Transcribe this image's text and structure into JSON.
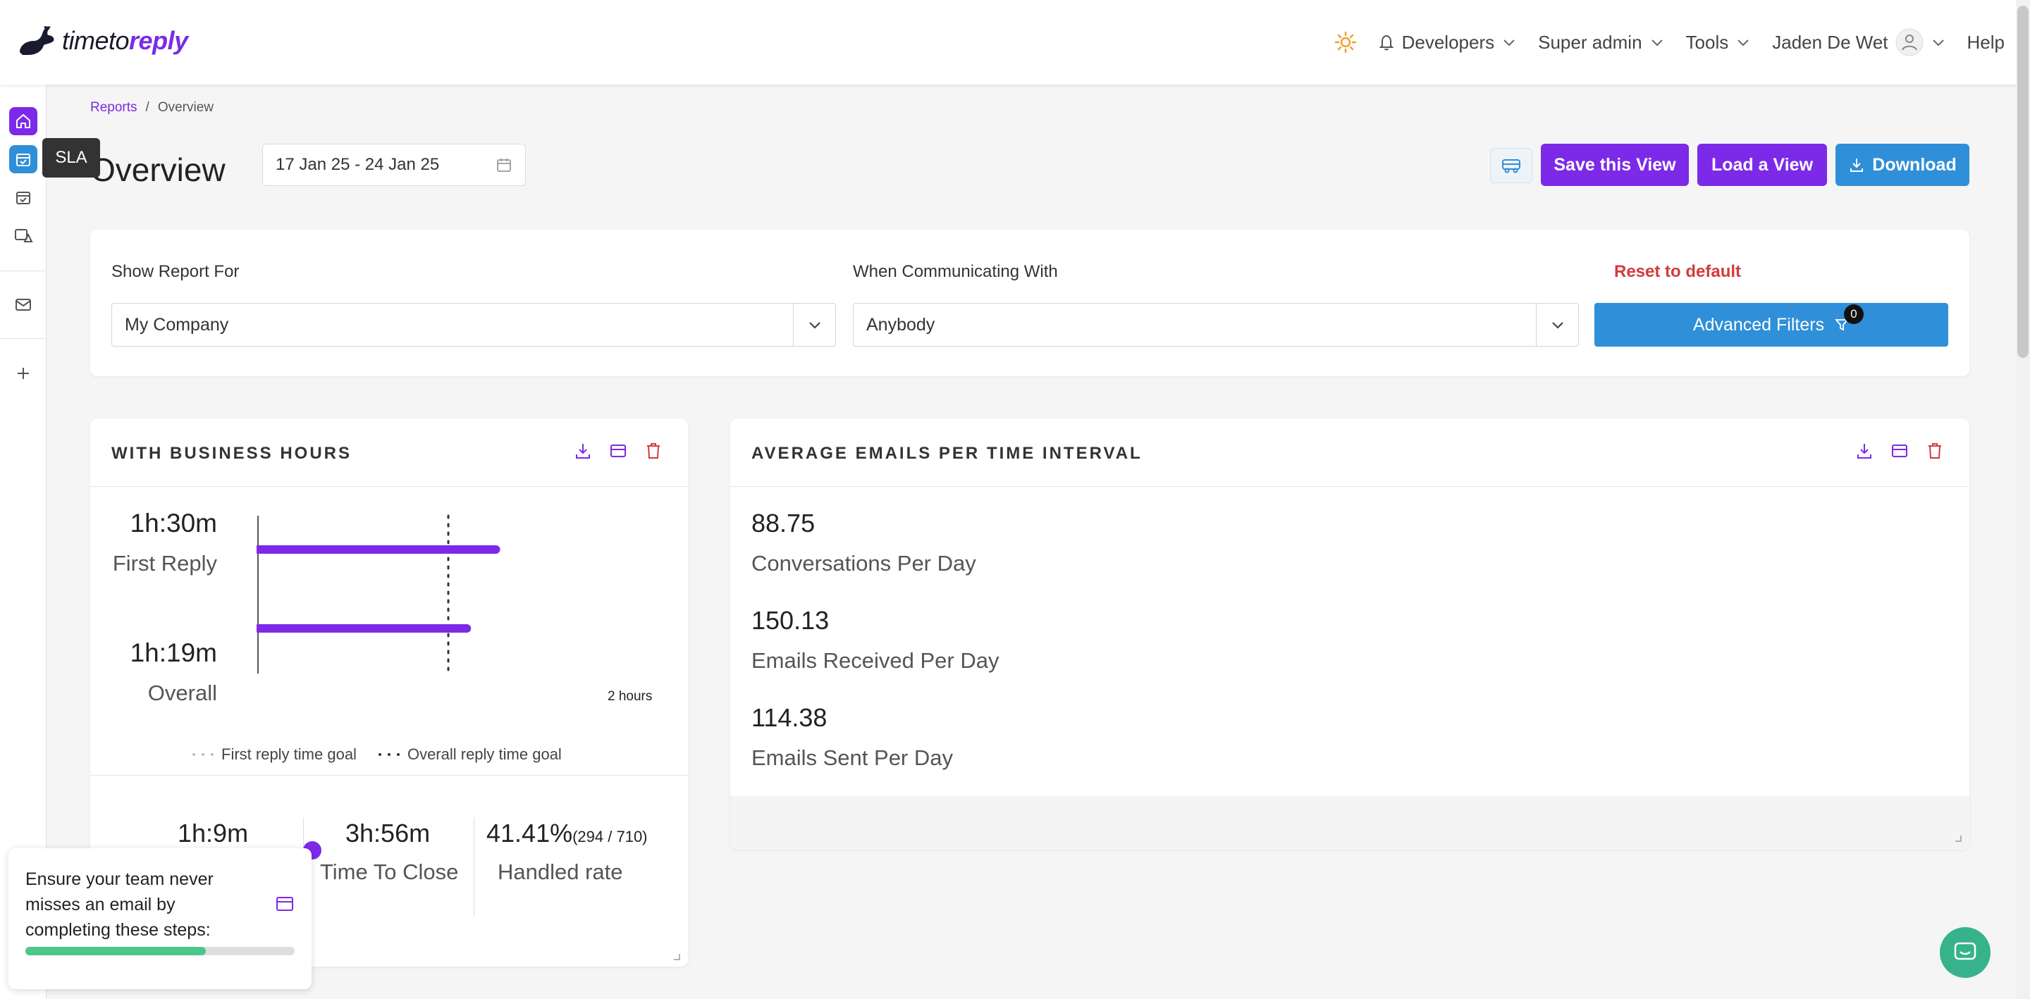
{
  "app": {
    "logo_text_light": "timeto",
    "logo_text_bold": "reply"
  },
  "nav": {
    "developers": "Developers",
    "super_admin": "Super admin",
    "tools": "Tools",
    "user": "Jaden De Wet",
    "help": "Help"
  },
  "sidebar": {
    "tooltip": "SLA"
  },
  "breadcrumb": {
    "reports": "Reports",
    "separator": "/",
    "current": "Overview"
  },
  "header": {
    "title": "Overview",
    "date_range": "17 Jan 25 - 24 Jan 25",
    "save_view": "Save this View",
    "load_view": "Load a View",
    "download": "Download"
  },
  "filters": {
    "report_for_label": "Show Report For",
    "report_for_value": "My Company",
    "communicating_label": "When Communicating With",
    "communicating_value": "Anybody",
    "reset": "Reset to default",
    "advanced": "Advanced Filters",
    "advanced_count": "0"
  },
  "business_hours": {
    "title": "WITH BUSINESS HOURS",
    "first_reply_time": "1h:30m",
    "first_reply_label": "First Reply",
    "overall_time": "1h:19m",
    "overall_label": "Overall",
    "axis_max_label": "2 hours",
    "legend_first": "First reply time goal",
    "legend_overall": "Overall reply time goal",
    "stat1_value": "1h:9m",
    "stat2_value": "3h:56m",
    "stat2_label": "Time To Close",
    "stat3_value": "41.41%",
    "stat3_detail": "(294 / 710)",
    "stat3_label": "Handled rate"
  },
  "chart_data": {
    "type": "bar",
    "orientation": "horizontal",
    "categories": [
      "First Reply",
      "Overall"
    ],
    "values_minutes": [
      90,
      79
    ],
    "xlim_minutes": [
      0,
      120
    ],
    "goal_minutes": 60,
    "bar_color": "#7c2ae8"
  },
  "average_emails": {
    "title": "AVERAGE EMAILS PER TIME INTERVAL",
    "metrics": [
      {
        "value": "88.75",
        "label": "Conversations Per Day"
      },
      {
        "value": "150.13",
        "label": "Emails Received Per Day"
      },
      {
        "value": "114.38",
        "label": "Emails Sent Per Day"
      }
    ]
  },
  "onboarding": {
    "text": "Ensure your team never misses an email by completing these steps:",
    "progress": 0.67
  },
  "colors": {
    "brand_purple": "#7c2ae8",
    "brand_blue": "#2f8fd8",
    "danger": "#d23b3b",
    "success": "#4cc78a"
  }
}
